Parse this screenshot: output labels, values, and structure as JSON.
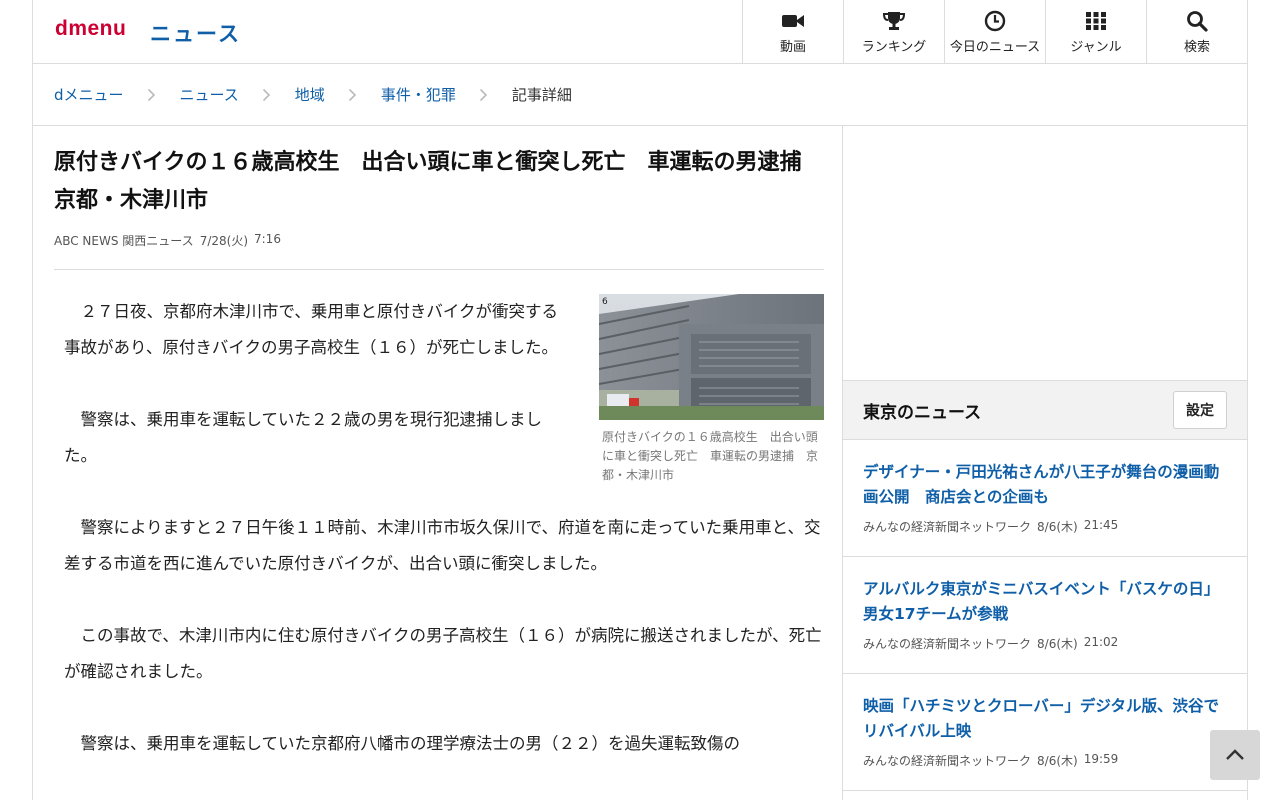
{
  "header": {
    "logo": "dmenu",
    "section_title": "ニュース",
    "nav": [
      {
        "label": "動画",
        "icon": "video-icon"
      },
      {
        "label": "ランキング",
        "icon": "trophy-icon"
      },
      {
        "label": "今日のニュース",
        "icon": "clock-icon"
      },
      {
        "label": "ジャンル",
        "icon": "grid-icon"
      },
      {
        "label": "検索",
        "icon": "search-icon"
      }
    ]
  },
  "breadcrumb": [
    "dメニュー",
    "ニュース",
    "地域",
    "事件・犯罪",
    "記事詳細"
  ],
  "article": {
    "title": "原付きバイクの１６歳高校生　出合い頭に車と衝突し死亡　車運転の男逮捕　京都・木津川市",
    "source": "ABC NEWS 関西ニュース",
    "date": "7/28(火)",
    "time": "7:16",
    "image_caption": "原付きバイクの１６歳高校生　出合い頭に車と衝突し死亡　車運転の男逮捕　京都・木津川市",
    "paragraphs": [
      "　２７日夜、京都府木津川市で、乗用車と原付きバイクが衝突する事故があり、原付きバイクの男子高校生（１６）が死亡しました。",
      "　警察は、乗用車を運転していた２２歳の男を現行犯逮捕しました。",
      "　警察によりますと２７日午後１１時前、木津川市市坂久保川で、府道を南に走っていた乗用車と、交差する市道を西に進んでいた原付きバイクが、出合い頭に衝突しました。",
      "　この事故で、木津川市内に住む原付きバイクの男子高校生（１６）が病院に搬送されましたが、死亡が確認されました。",
      "　警察は、乗用車を運転していた京都府八幡市の理学療法士の男（２２）を過失運転致傷の"
    ]
  },
  "sidebar": {
    "title": "東京のニュース",
    "settings_label": "設定",
    "items": [
      {
        "title": "デザイナー・戸田光祐さんが八王子が舞台の漫画動画公開　商店会との企画も",
        "source": "みんなの経済新聞ネットワーク",
        "date": "8/6(木)",
        "time": "21:45"
      },
      {
        "title": "アルバルク東京がミニバスイベント「バスケの日」　男女17チームが参戦",
        "source": "みんなの経済新聞ネットワーク",
        "date": "8/6(木)",
        "time": "21:02"
      },
      {
        "title": "映画「ハチミツとクローバー」デジタル版、渋谷でリバイバル上映",
        "source": "みんなの経済新聞ネットワーク",
        "date": "8/6(木)",
        "time": "19:59"
      }
    ]
  },
  "colors": {
    "brand_red": "#cc0033",
    "link_blue": "#0f5fa8"
  }
}
